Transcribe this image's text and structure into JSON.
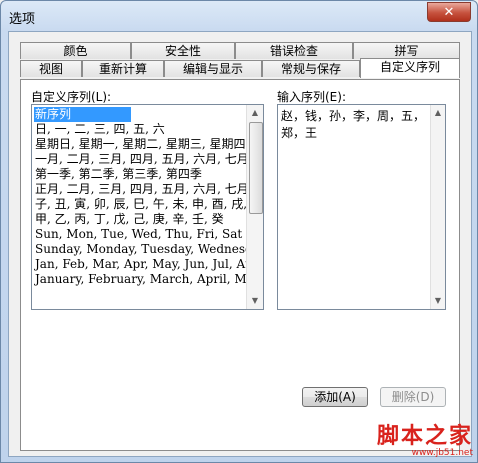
{
  "window": {
    "title": "选项",
    "close_glyph": "✕"
  },
  "tabs_top_row": [
    {
      "label": "颜色"
    },
    {
      "label": "安全性"
    },
    {
      "label": "错误检查"
    },
    {
      "label": "拼写"
    }
  ],
  "tabs_bottom_row": [
    {
      "label": "视图"
    },
    {
      "label": "重新计算"
    },
    {
      "label": "编辑与显示"
    },
    {
      "label": "常规与保存"
    },
    {
      "label": "自定义序列",
      "active": true
    }
  ],
  "custom_lists": {
    "label": "自定义序列(L):",
    "items": [
      "新序列",
      "日, 一, 二, 三, 四, 五, 六",
      "星期日, 星期一, 星期二, 星期三, 星期四, 星期五, 星期六",
      "一月, 二月, 三月, 四月, 五月, 六月, 七月, 八月, 九月, 十月, 十一月, 十二月",
      "第一季, 第二季, 第三季, 第四季",
      "正月, 二月, 三月, 四月, 五月, 六月, 七月, 八月, 九月, 十月, 十一月, 腊月",
      "子, 丑, 寅, 卯, 辰, 巳, 午, 未, 申, 酉, 戌, 亥",
      "甲, 乙, 丙, 丁, 戊, 己, 庚, 辛, 壬, 癸",
      "Sun, Mon, Tue, Wed, Thu, Fri, Sat",
      "Sunday, Monday, Tuesday, Wednesday, Thursday, Friday, Saturday",
      "Jan, Feb, Mar, Apr, May, Jun, Jul, Aug, Sep, Oct, Nov, Dec",
      "January, February, March, April, May, June, July, August"
    ],
    "selected_index": 0
  },
  "input_sequence": {
    "label": "输入序列(E):",
    "value": "赵，钱，孙，李，周，五，郑，王"
  },
  "buttons": {
    "add": "添加(A)",
    "delete": "删除(D)",
    "ok": "确定",
    "cancel": "取消"
  },
  "watermark": {
    "title": "脚本之家",
    "url": "www.jb51.net"
  }
}
